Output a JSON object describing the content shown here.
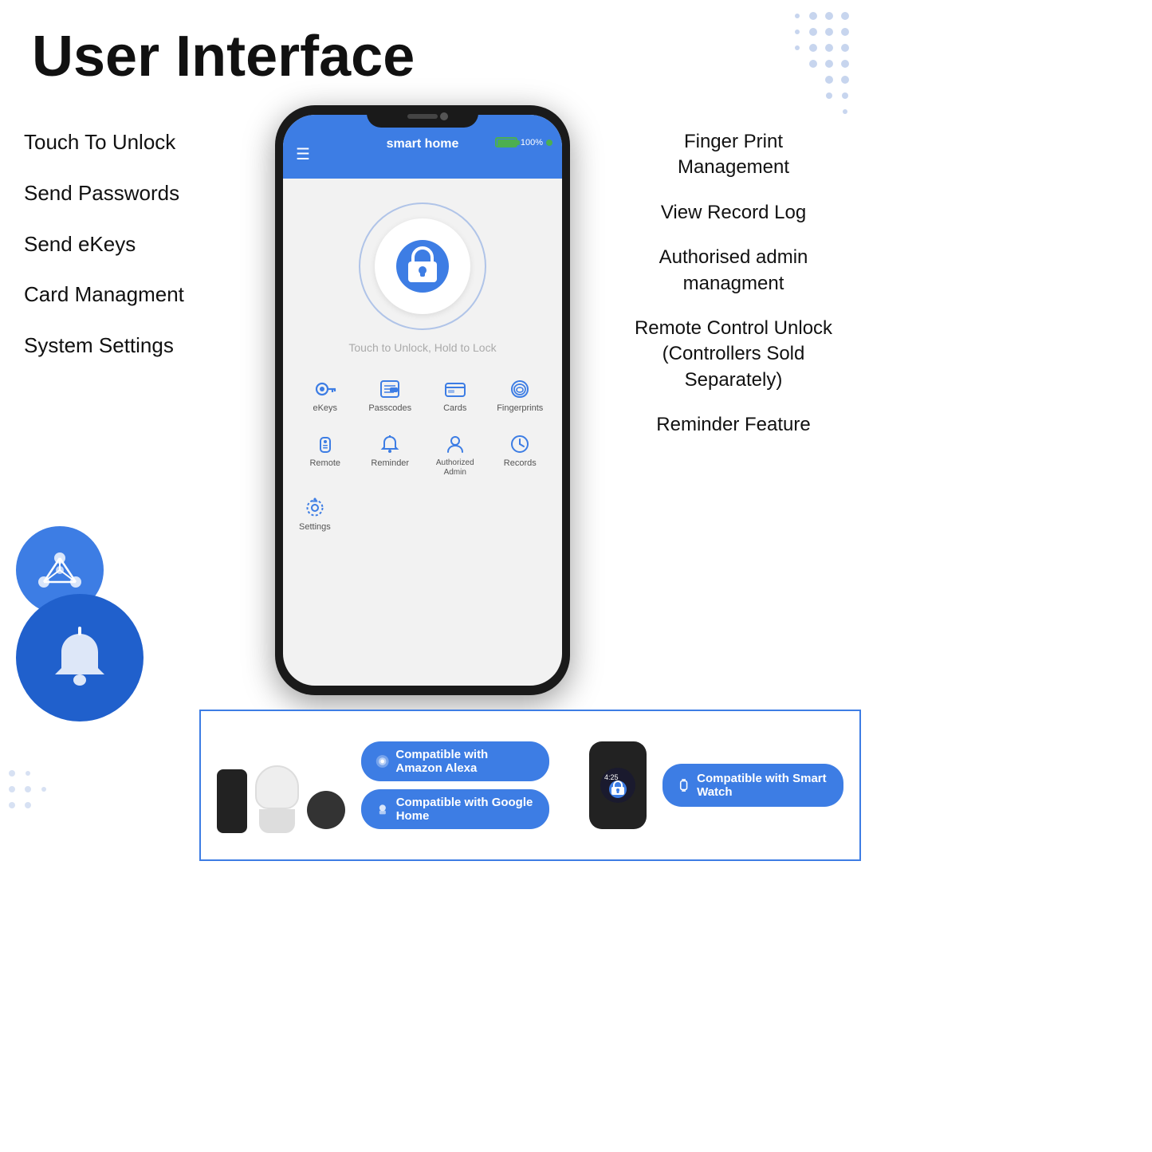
{
  "page": {
    "title": "User Interface"
  },
  "left_features": [
    "Touch To Unlock",
    "Send Passwords",
    "Send eKeys",
    "Card Managment",
    "System Settings"
  ],
  "right_features": [
    "Finger Print Management",
    "View Record Log",
    "Authorised admin managment",
    "Remote Control Unlock (Controllers Sold Separately)",
    "Reminder Feature"
  ],
  "phone": {
    "app_title": "smart home",
    "battery_text": "100%",
    "lock_hint": "Touch to Unlock, Hold to Lock",
    "menu_icon": "☰",
    "icons_row1": [
      {
        "label": "eKeys",
        "icon": "🔑"
      },
      {
        "label": "Passcodes",
        "icon": "🗒"
      },
      {
        "label": "Cards",
        "icon": "💳"
      },
      {
        "label": "Fingerprints",
        "icon": "👆"
      }
    ],
    "icons_row2": [
      {
        "label": "Remote",
        "icon": "📡"
      },
      {
        "label": "Reminder",
        "icon": "🔔"
      },
      {
        "label": "Authorized Admin",
        "icon": "👤"
      },
      {
        "label": "Records",
        "icon": "🕐"
      }
    ],
    "settings_label": "Settings"
  },
  "compatibility": {
    "alexa": "Compatible with Amazon Alexa",
    "google": "Compatible with Google Home",
    "watch": "Compatible with Smart Watch"
  }
}
